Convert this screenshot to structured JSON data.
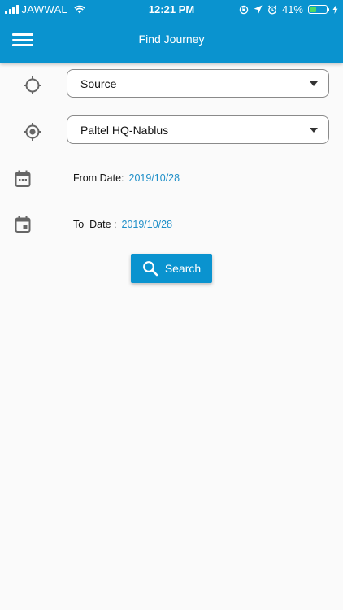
{
  "status_bar": {
    "carrier": "JAWWAL",
    "time": "12:21 PM",
    "battery_percent": "41%",
    "battery_level": 0.41
  },
  "app_bar": {
    "title": "Find Journey",
    "menu_icon": "hamburger-menu-icon"
  },
  "form": {
    "source": {
      "selected": "Source",
      "icon": "crosshair-icon"
    },
    "destination": {
      "selected": "Paltel HQ-Nablus",
      "icon": "gps-fixed-icon"
    },
    "from_date": {
      "label": "From Date:",
      "value": "2019/10/28",
      "icon": "calendar-icon"
    },
    "to_date": {
      "label": "To  Date :",
      "value": "2019/10/28",
      "icon": "calendar-event-icon"
    },
    "search_label": "Search",
    "search_icon": "search-icon"
  },
  "colors": {
    "primary": "#0a93cf",
    "date_value": "#1e8fc8",
    "icon": "#666666"
  }
}
